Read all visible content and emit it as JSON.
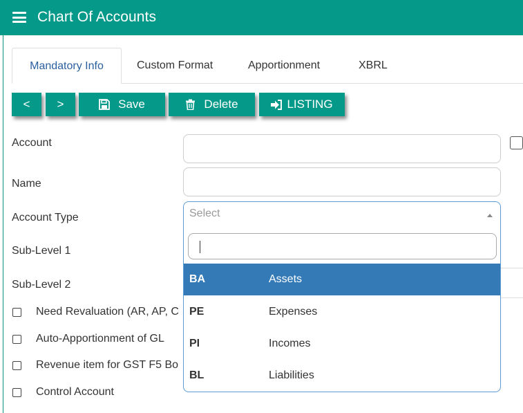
{
  "header": {
    "title": "Chart Of Accounts"
  },
  "tabs": [
    {
      "label": "Mandatory Info",
      "active": true
    },
    {
      "label": "Custom Format"
    },
    {
      "label": "Apportionment"
    },
    {
      "label": "XBRL"
    }
  ],
  "toolbar": {
    "prev_label": "<",
    "next_label": ">",
    "save_label": "Save",
    "delete_label": "Delete",
    "listing_label": "LISTING"
  },
  "form": {
    "account_label": "Account",
    "account_value": "",
    "name_label": "Name",
    "name_value": "",
    "account_type_label": "Account Type",
    "account_type_placeholder": "Select",
    "sublevel1_label": "Sub-Level 1",
    "sublevel2_label": "Sub-Level 2"
  },
  "checkboxes": [
    {
      "label": "Need Revaluation (AR, AP, C",
      "checked": false
    },
    {
      "label": "Auto-Apportionment of GL",
      "checked": false
    },
    {
      "label": "Revenue item for GST F5 Bo",
      "checked": false
    },
    {
      "label": "Control Account",
      "checked": false
    }
  ],
  "dropdown": {
    "search_value": "",
    "options": [
      {
        "code": "BA",
        "name": "Assets",
        "highlighted": true
      },
      {
        "code": "PE",
        "name": "Expenses"
      },
      {
        "code": "PI",
        "name": "Incomes"
      },
      {
        "code": "BL",
        "name": "Liabilities"
      }
    ]
  },
  "colors": {
    "brand": "#059989",
    "highlight": "#337ab7",
    "active_tab_text": "#2a5f9e"
  }
}
